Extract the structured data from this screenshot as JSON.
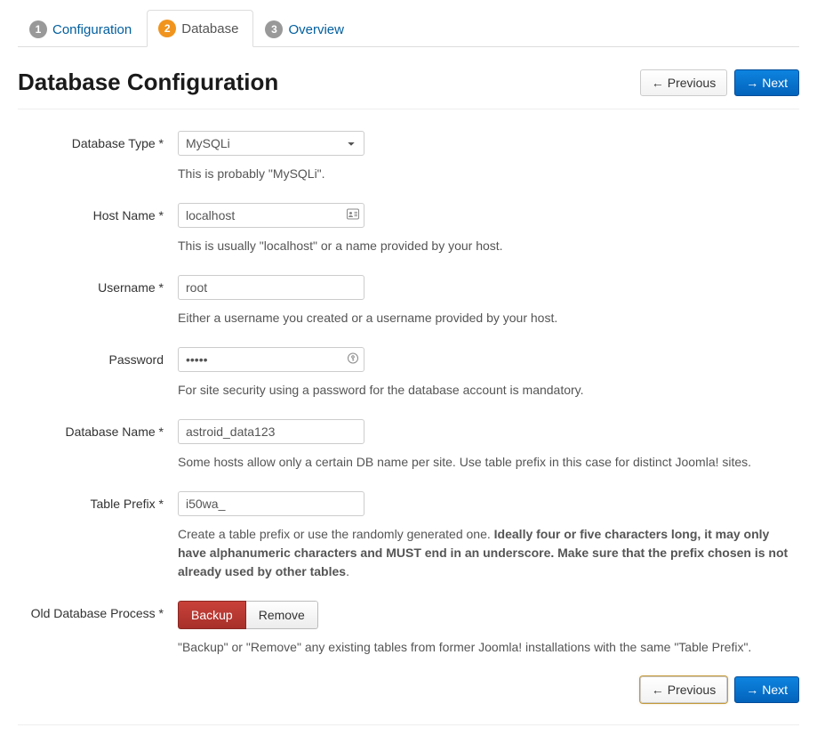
{
  "tabs": [
    {
      "num": "1",
      "label": "Configuration"
    },
    {
      "num": "2",
      "label": "Database"
    },
    {
      "num": "3",
      "label": "Overview"
    }
  ],
  "page_title": "Database Configuration",
  "buttons": {
    "previous": "Previous",
    "next": "Next"
  },
  "fields": {
    "db_type": {
      "label": "Database Type *",
      "value": "MySQLi",
      "help": "This is probably \"MySQLi\"."
    },
    "host": {
      "label": "Host Name *",
      "value": "localhost",
      "help": "This is usually \"localhost\" or a name provided by your host."
    },
    "username": {
      "label": "Username *",
      "value": "root",
      "help": "Either a username you created or a username provided by your host."
    },
    "password": {
      "label": "Password",
      "value": "•••••",
      "help": "For site security using a password for the database account is mandatory."
    },
    "dbname": {
      "label": "Database Name *",
      "value": "astroid_data123",
      "help": "Some hosts allow only a certain DB name per site. Use table prefix in this case for distinct Joomla! sites."
    },
    "prefix": {
      "label": "Table Prefix *",
      "value": "i50wa_",
      "help_plain": "Create a table prefix or use the randomly generated one. ",
      "help_strong": "Ideally four or five characters long, it may only have alphanumeric characters and MUST end in an underscore. Make sure that the prefix chosen is not already used by other tables"
    },
    "olddb": {
      "label": "Old Database Process *",
      "backup": "Backup",
      "remove": "Remove",
      "help": "\"Backup\" or \"Remove\" any existing tables from former Joomla! installations with the same \"Table Prefix\"."
    }
  }
}
